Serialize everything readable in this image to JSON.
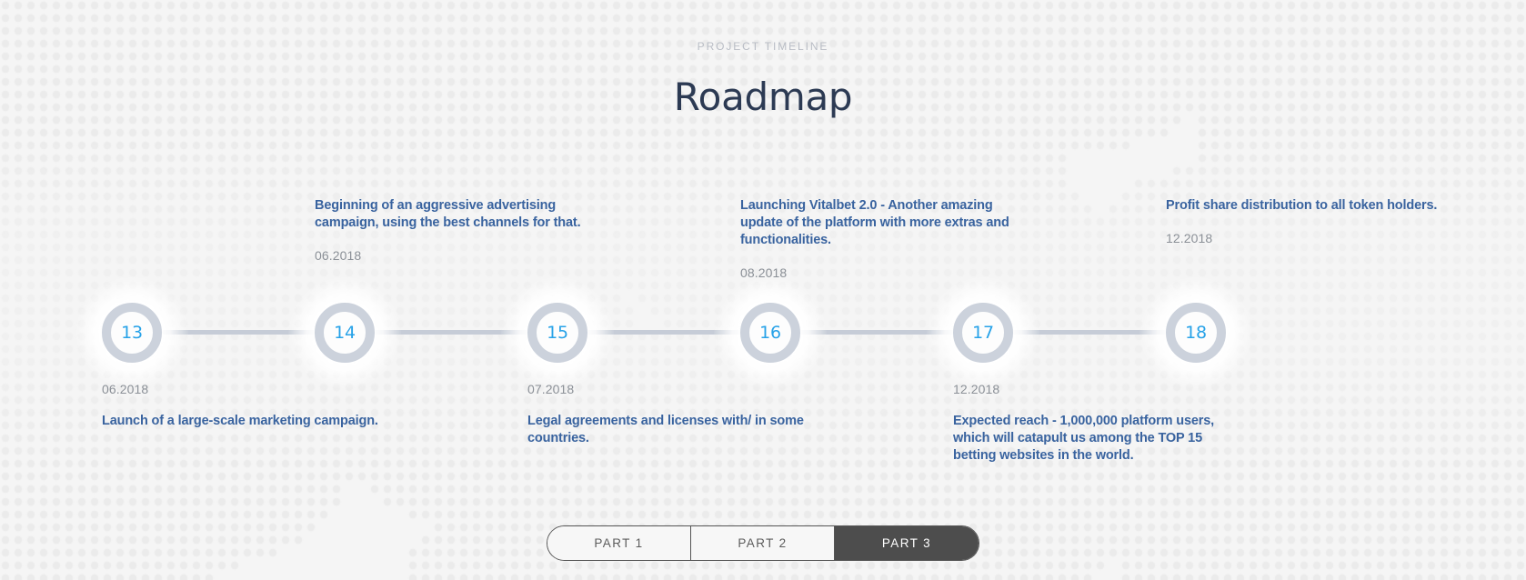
{
  "header": {
    "eyebrow": "PROJECT TIMELINE",
    "title": "Roadmap"
  },
  "colors": {
    "background": "#f5f5f5",
    "dots": "#ebebeb",
    "title": "#2c3a53",
    "eyebrow": "#b9bdc5",
    "description": "#39639f",
    "date": "#8b9097",
    "node_number": "#27a2e8",
    "node_ring": "#ccd2dc",
    "axis_line": "#c6ccd7",
    "tab_active_bg": "#4d4d4d",
    "tab_inactive_bg": "#f7f7f7"
  },
  "timeline": {
    "nodes": [
      {
        "number": "13",
        "date": "06.2018",
        "description": "Launch of a large-scale marketing campaign.",
        "position": "below"
      },
      {
        "number": "14",
        "date": "06.2018",
        "description": "Beginning of an aggressive advertising campaign, using the best channels for that.",
        "position": "above"
      },
      {
        "number": "15",
        "date": "07.2018",
        "description": "Legal agreements and licenses with/ in some countries.",
        "position": "below"
      },
      {
        "number": "16",
        "date": "08.2018",
        "description": "Launching Vitalbet 2.0 - Another amazing update of the platform with more extras and functionalities.",
        "position": "above"
      },
      {
        "number": "17",
        "date": "12.2018",
        "description": "Expected reach - 1,000,000 platform users, which will catapult us among the TOP 15 betting websites in the world.",
        "position": "below"
      },
      {
        "number": "18",
        "date": "12.2018",
        "description": "Profit share distribution to all token holders.",
        "position": "above"
      }
    ]
  },
  "parts": {
    "tabs": [
      {
        "label": "PART 1",
        "active": false
      },
      {
        "label": "PART 2",
        "active": false
      },
      {
        "label": "PART 3",
        "active": true
      }
    ]
  }
}
